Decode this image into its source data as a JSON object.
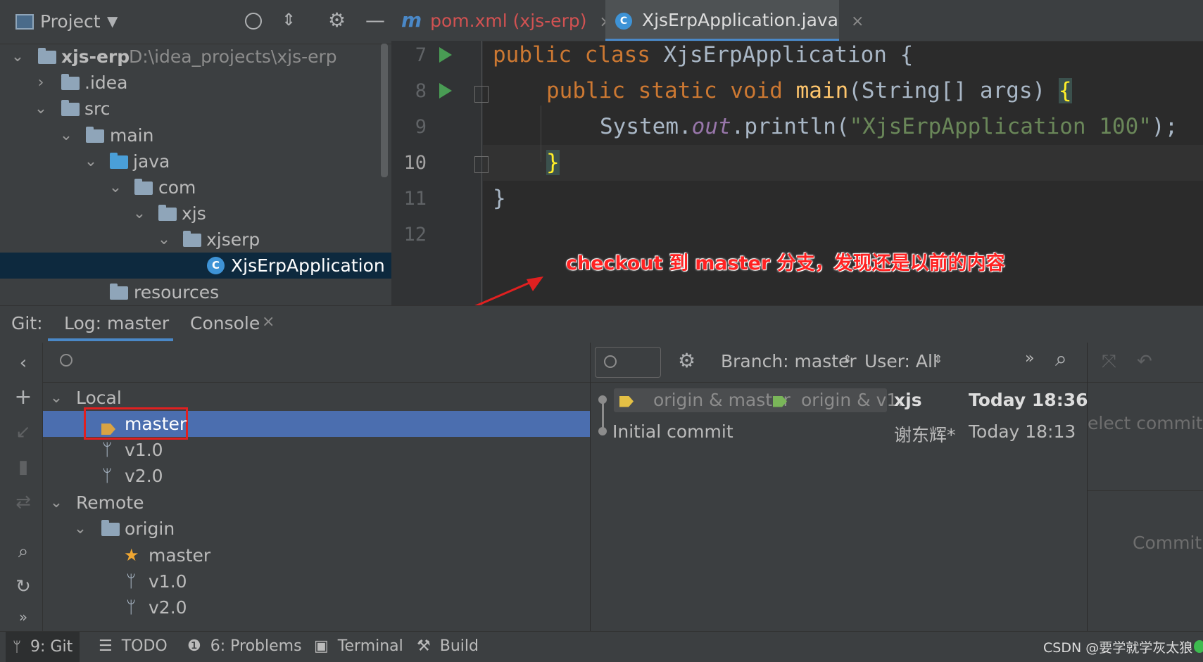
{
  "project": {
    "title": "Project",
    "tree": [
      {
        "label": "xjs-erp",
        "path": "D:\\idea_projects\\xjs-erp"
      },
      {
        "label": ".idea"
      },
      {
        "label": "src"
      },
      {
        "label": "main"
      },
      {
        "label": "java"
      },
      {
        "label": "com"
      },
      {
        "label": "xjs"
      },
      {
        "label": "xjserp"
      },
      {
        "label": "XjsErpApplication"
      },
      {
        "label": "resources"
      }
    ]
  },
  "editor": {
    "tabs": [
      {
        "label": "pom.xml (xjs-erp)",
        "icon": "maven-icon"
      },
      {
        "label": "XjsErpApplication.java",
        "icon": "class-icon"
      }
    ],
    "line_numbers": [
      "7",
      "8",
      "9",
      "10",
      "11",
      "12"
    ],
    "code": {
      "l7_kw": "public class ",
      "l7_rest": "XjsErpApplication {",
      "l8_kw": "public static void ",
      "l8_fn": "main",
      "l8_rest": "(String[] args) ",
      "l8_brace": "{",
      "l9_a": "System.",
      "l9_it": "out",
      "l9_b": ".println(",
      "l9_str": "\"XjsErpApplication 100\"",
      "l9_c": ");",
      "l10": "}",
      "l11": "}"
    }
  },
  "annotation": "checkout 到 master 分支，发现还是以前的内容",
  "git": {
    "label": "Git:",
    "tabs": [
      {
        "label": "Log: master"
      },
      {
        "label": "Console"
      }
    ],
    "branches": {
      "local_label": "Local",
      "local": [
        "master",
        "v1.0",
        "v2.0"
      ],
      "remote_label": "Remote",
      "origin_label": "origin",
      "remote": [
        "master",
        "v1.0",
        "v2.0"
      ]
    },
    "log": {
      "branch_filter": "Branch: master",
      "user_filter": "User: All",
      "commits": [
        {
          "refs": "origin & master",
          "refs2": "origin & v1.",
          "author": "xjs",
          "date": "Today 18:36"
        },
        {
          "message": "Initial commit",
          "author": "谢东辉*",
          "date": "Today 18:13"
        }
      ]
    },
    "details": {
      "hint": "elect commit to",
      "hint2": "Commit d"
    }
  },
  "statusbar": {
    "items": [
      "9: Git",
      "TODO",
      "6: Problems",
      "Terminal",
      "Build"
    ],
    "watermark": "CSDN @要学就学灰太狼"
  },
  "colors": {
    "accent": "#4a88c7",
    "selection": "#4b6eaf",
    "annotation": "#ff2222"
  }
}
